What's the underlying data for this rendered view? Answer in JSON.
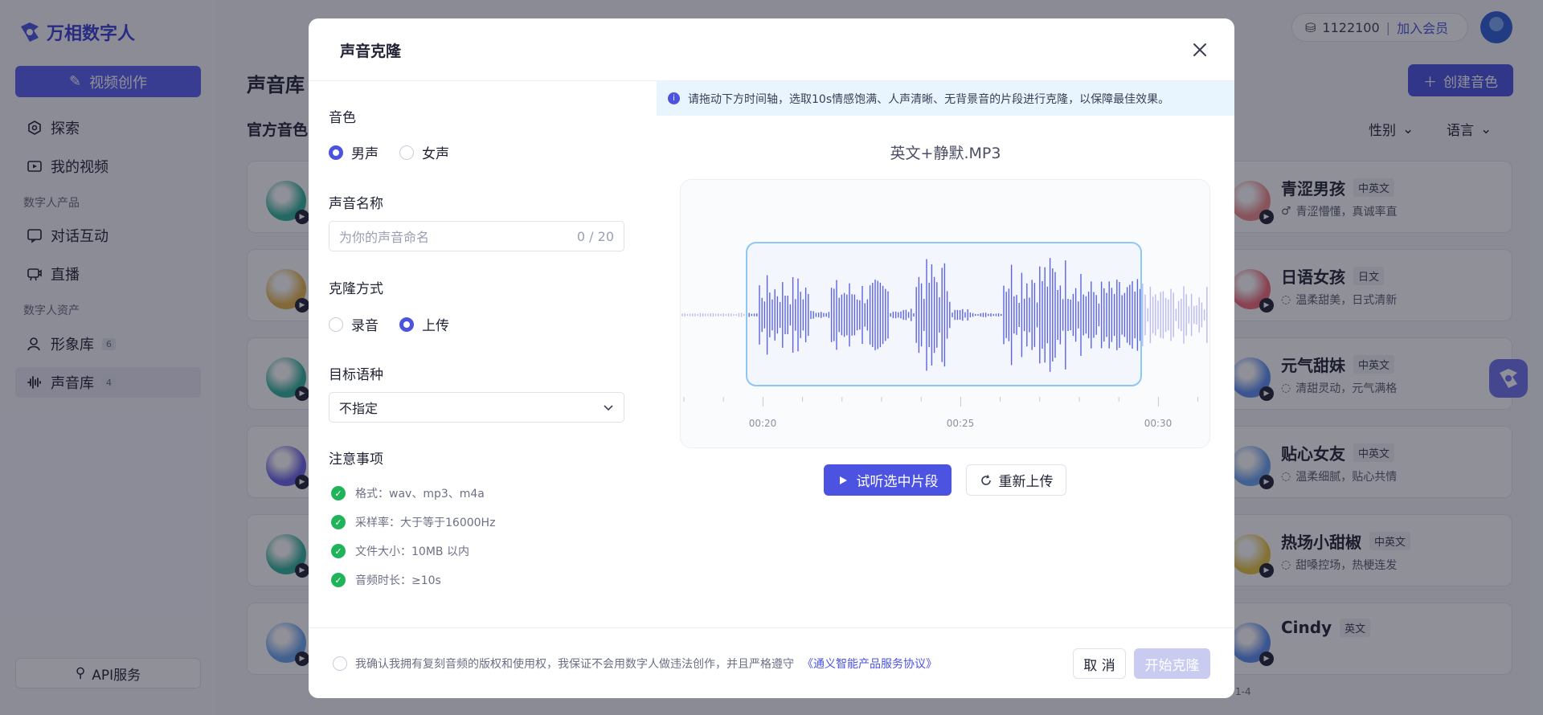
{
  "app": {
    "logo_text": "万相数字人",
    "create_video": "视频创作",
    "nav": [
      {
        "label": "探索",
        "icon": "compass-icon"
      },
      {
        "label": "我的视频",
        "icon": "video-icon"
      },
      {
        "label": "对话互动",
        "icon": "chat-icon"
      },
      {
        "label": "直播",
        "icon": "live-icon"
      },
      {
        "label": "形象库",
        "icon": "person-icon",
        "badge": "6"
      },
      {
        "label": "声音库",
        "icon": "waveform-icon",
        "badge": "4"
      }
    ],
    "groups": {
      "product": "数字人产品",
      "assets": "数字人资产"
    },
    "api_service": "API服务",
    "credits": "1122100",
    "separator": "|",
    "join_vip": "加入会员",
    "page_title": "声音库",
    "section_title": "官方音色",
    "create_voice": "创建音色",
    "filters": {
      "gender": "性别",
      "language": "语言"
    },
    "footer_snip": "1-4"
  },
  "voice_cards": [
    {
      "name": "青涩男孩",
      "lang": "中英文",
      "desc": "青涩懵懂，真诚率直",
      "desc_icon": "male-icon",
      "left_color": "#2fb39a",
      "right_color": "#f08a8a"
    },
    {
      "name": "日语女孩",
      "lang": "日文",
      "desc": "温柔甜美，日式清新",
      "desc_icon": "chat-bubble-icon",
      "left_color": "#e6b54a",
      "right_color": "#f06a78"
    },
    {
      "name": "元气甜妹",
      "lang": "中英文",
      "desc": "清甜灵动，元气满格",
      "desc_icon": "chat-bubble-icon",
      "left_color": "#2fb39a",
      "right_color": "#5a8ef0"
    },
    {
      "name": "贴心女友",
      "lang": "中英文",
      "desc": "温柔细腻，贴心共情",
      "desc_icon": "chat-bubble-icon",
      "left_color": "#6b63ea",
      "right_color": "#6aa4f0"
    },
    {
      "name": "热场小甜椒",
      "lang": "中英文",
      "desc": "甜嗓控场，热梗连发",
      "desc_icon": "chat-bubble-icon",
      "left_color": "#2fb39a",
      "right_color": "#e8c640"
    },
    {
      "name": "Cindy",
      "lang": "英文",
      "desc": "",
      "desc_icon": "chat-bubble-icon",
      "left_color": "#6aa4f0",
      "right_color": "#5a8ef0"
    }
  ],
  "modal": {
    "title": "声音克隆",
    "timbre_label": "音色",
    "timbre_options": [
      "男声",
      "女声"
    ],
    "timbre_selected": 0,
    "name_label": "声音名称",
    "name_placeholder": "为你的声音命名",
    "name_count": "0 / 20",
    "method_label": "克隆方式",
    "method_options": [
      "录音",
      "上传"
    ],
    "method_selected": 1,
    "target_lang_label": "目标语种",
    "target_lang_value": "不指定",
    "notes_label": "注意事项",
    "notes": [
      "格式：wav、mp3、m4a",
      "采样率：大于等于16000Hz",
      "文件大小：10MB 以内",
      "音频时长：≥10s"
    ],
    "info_text": "请拖动下方时间轴，选取10s情感饱满、人声清晰、无背景音的片段进行克隆，以保障最佳效果。",
    "file_name": "英文+静默.MP3",
    "timeline": {
      "labels": [
        "00:20",
        "00:25",
        "00:30"
      ],
      "selection_start_sec": 20,
      "selection_end_sec": 30
    },
    "listen_btn": "试听选中片段",
    "reupload_btn": "重新上传",
    "agree_text": "我确认我拥有复刻音频的版权和使用权，我保证不会用数字人做违法创作，并且严格遵守",
    "agree_link": "《通义智能产品服务协议》",
    "cancel_btn": "取 消",
    "start_btn": "开始克隆"
  },
  "colors": {
    "accent": "#4b53e0",
    "success": "#1fb45a",
    "info_bg": "#e8f4fe"
  }
}
